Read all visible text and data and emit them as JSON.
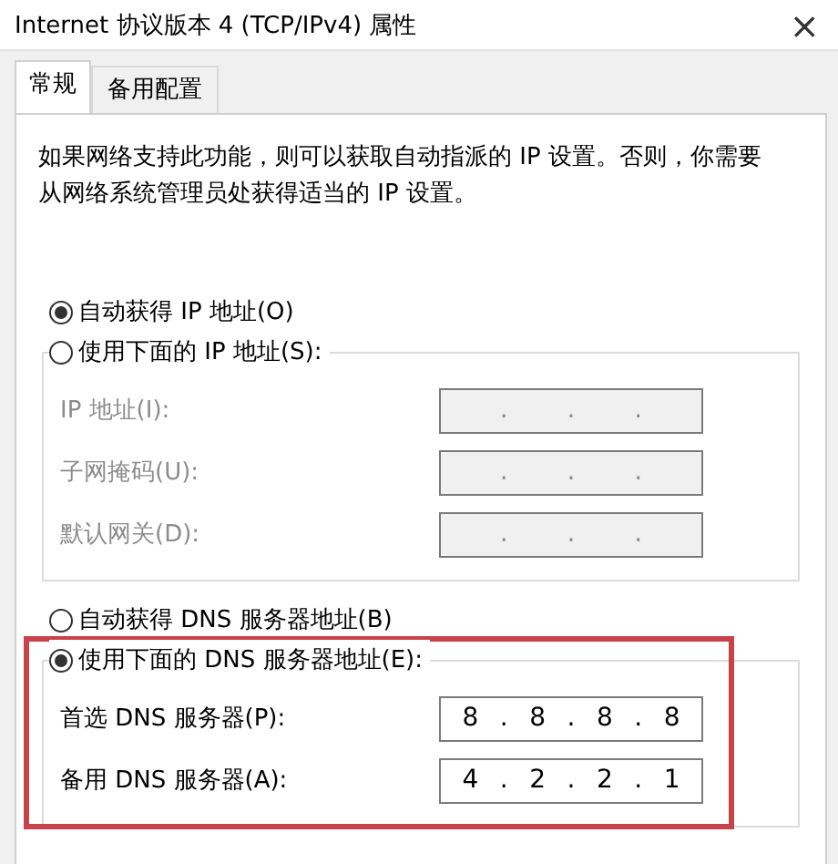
{
  "window": {
    "title": "Internet 协议版本 4 (TCP/IPv4) 属性",
    "close": "×"
  },
  "tabs": [
    {
      "label": "常规",
      "selected": true
    },
    {
      "label": "备用配置",
      "selected": false
    }
  ],
  "description": "如果网络支持此功能，则可以获取自动指派的 IP 设置。否则，你需要从网络系统管理员处获得适当的 IP 设置。",
  "ip_section": {
    "auto_option": {
      "label": "自动获得 IP 地址(O)",
      "selected": true
    },
    "manual_option": {
      "label": "使用下面的 IP 地址(S):",
      "selected": false
    },
    "fields": [
      {
        "label": "IP 地址(I):",
        "disabled": true,
        "dots": [
          ".",
          ".",
          "."
        ]
      },
      {
        "label": "子网掩码(U):",
        "disabled": true,
        "dots": [
          ".",
          ".",
          "."
        ]
      },
      {
        "label": "默认网关(D):",
        "disabled": true,
        "dots": [
          ".",
          ".",
          "."
        ]
      }
    ]
  },
  "dns_section": {
    "highlighted": true,
    "auto_option": {
      "label": "自动获得 DNS 服务器地址(B)",
      "selected": false
    },
    "manual_option": {
      "label": "使用下面的 DNS 服务器地址(E):",
      "selected": true
    },
    "fields": [
      {
        "label": "首选 DNS 服务器(P):",
        "disabled": false,
        "octets": [
          "8",
          "8",
          "8",
          "8"
        ],
        "dots": [
          ".",
          ".",
          "."
        ]
      },
      {
        "label": "备用 DNS 服务器(A):",
        "disabled": false,
        "octets": [
          "4",
          "2",
          "2",
          "1"
        ],
        "dots": [
          ".",
          ".",
          "."
        ]
      }
    ]
  }
}
